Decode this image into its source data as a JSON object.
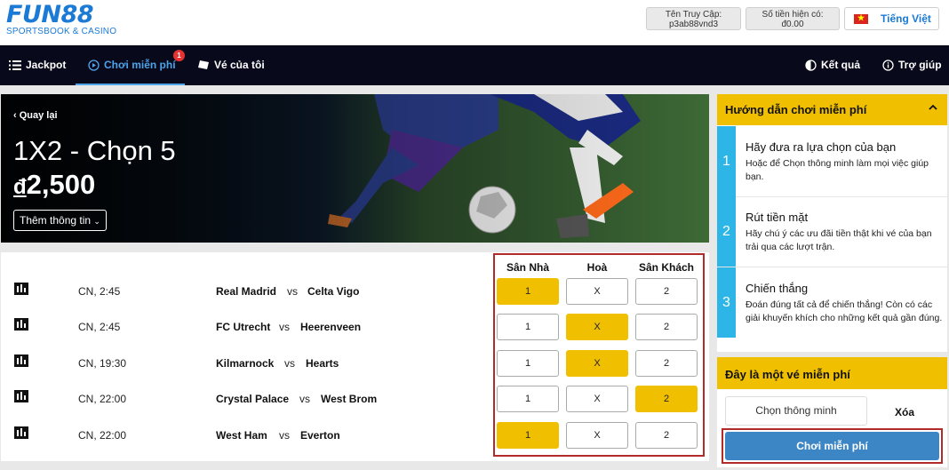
{
  "brand": {
    "name": "FUN88",
    "tagline": "SPORTSBOOK & CASINO"
  },
  "account": {
    "login_label": "Tên Truy Cập:",
    "login_value": "p3ab88vnd3",
    "balance_label": "Số tiền hiện có:",
    "balance_value": "đ0.00"
  },
  "language": {
    "label": "Tiếng Việt"
  },
  "nav": {
    "jackpot": "Jackpot",
    "free_play": "Chơi miễn phí",
    "free_play_badge": "1",
    "my_tickets": "Vé của tôi",
    "results": "Kết quả",
    "help": "Trợ giúp"
  },
  "hero": {
    "back": "Quay lại",
    "title": "1X2 - Chọn 5",
    "currency": "đ",
    "prize": "2,500",
    "more_info": "Thêm thông tin"
  },
  "odds_headers": {
    "home": "Sân Nhà",
    "draw": "Hoà",
    "away": "Sân Khách"
  },
  "matches": [
    {
      "time": "CN, 2:45",
      "home": "Real Madrid",
      "vs": "vs",
      "away": "Celta Vigo",
      "odds": [
        "1",
        "X",
        "2"
      ],
      "selected": "1"
    },
    {
      "time": "CN, 2:45",
      "home": "FC Utrecht",
      "vs": "vs",
      "away": "Heerenveen",
      "odds": [
        "1",
        "X",
        "2"
      ],
      "selected": "X"
    },
    {
      "time": "CN, 19:30",
      "home": "Kilmarnock",
      "vs": "vs",
      "away": "Hearts",
      "odds": [
        "1",
        "X",
        "2"
      ],
      "selected": "X"
    },
    {
      "time": "CN, 22:00",
      "home": "Crystal Palace",
      "vs": "vs",
      "away": "West Brom",
      "odds": [
        "1",
        "X",
        "2"
      ],
      "selected": "2"
    },
    {
      "time": "CN, 22:00",
      "home": "West Ham",
      "vs": "vs",
      "away": "Everton",
      "odds": [
        "1",
        "X",
        "2"
      ],
      "selected": "1"
    }
  ],
  "guide": {
    "title": "Hướng dẫn chơi miễn phí",
    "steps": [
      {
        "num": "1",
        "title": "Hãy đưa ra lựa chọn của bạn",
        "desc": "Hoặc để Chọn thông minh làm mọi việc giúp bạn."
      },
      {
        "num": "2",
        "title": "Rút tiền mặt",
        "desc": "Hãy chú ý các ưu đãi tiền thật khi vé của bạn trải qua các lượt trận."
      },
      {
        "num": "3",
        "title": "Chiến thắng",
        "desc": "Đoán đúng tất cả để chiến thắng! Còn có các giải khuyến khích cho những kết quả gần đúng."
      }
    ]
  },
  "ticket": {
    "title": "Đây là một vé miễn phí",
    "smart_pick": "Chọn thông minh",
    "clear": "Xóa",
    "play": "Chơi miễn phí"
  },
  "colors": {
    "accent": "#f0c000",
    "nav_bg": "#08091a",
    "active": "#4fa3e8",
    "step": "#2db5e8",
    "play": "#3d86c6",
    "highlight_border": "#b32a2a"
  }
}
